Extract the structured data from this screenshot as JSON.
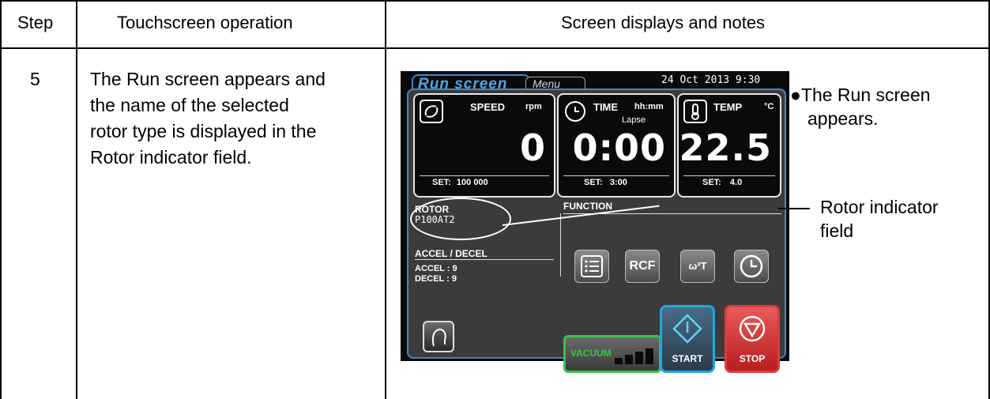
{
  "table": {
    "headers": {
      "step": "Step",
      "operation": "Touchscreen operation",
      "notes": "Screen displays and notes"
    },
    "row": {
      "step": "5",
      "operation_lines": [
        "The Run screen appears and",
        "the name of the selected",
        "rotor type is displayed in the",
        "Rotor indicator field."
      ]
    }
  },
  "device": {
    "tab_run": "Run screen",
    "tab_menu": "Menu",
    "datetime": "24 Oct 2013   9:30",
    "speed": {
      "label": "SPEED",
      "unit": "rpm",
      "value": "0",
      "set_label": "SET:",
      "set_value": "100 000"
    },
    "time": {
      "label": "TIME",
      "unit": "hh:mm",
      "sub": "Lapse",
      "value": "0:00",
      "set_label": "SET:",
      "set_value": "3:00"
    },
    "temp": {
      "label": "TEMP",
      "unit": "°C",
      "value": "22.5",
      "set_label": "SET:",
      "set_value": "4.0"
    },
    "rotor": {
      "label": "ROTOR",
      "value": "P100AT2"
    },
    "function": {
      "label": "FUNCTION",
      "buttons": [
        "RCF",
        "ω²T"
      ]
    },
    "accel_decel": {
      "label": "ACCEL / DECEL",
      "accel": "ACCEL : 9",
      "decel": "DECEL : 9"
    },
    "vacuum": "VACUUM",
    "start": "START",
    "stop": "STOP"
  },
  "notes": {
    "bullet": "●",
    "note1_lines": [
      "The Run screen",
      "appears."
    ],
    "callout_lines": [
      "Rotor indicator",
      "field"
    ]
  },
  "colors": {
    "accent": "#3d87c7",
    "vacuum": "#36c24a",
    "start": "#1fa8e0",
    "stop": "#e23a3a"
  }
}
